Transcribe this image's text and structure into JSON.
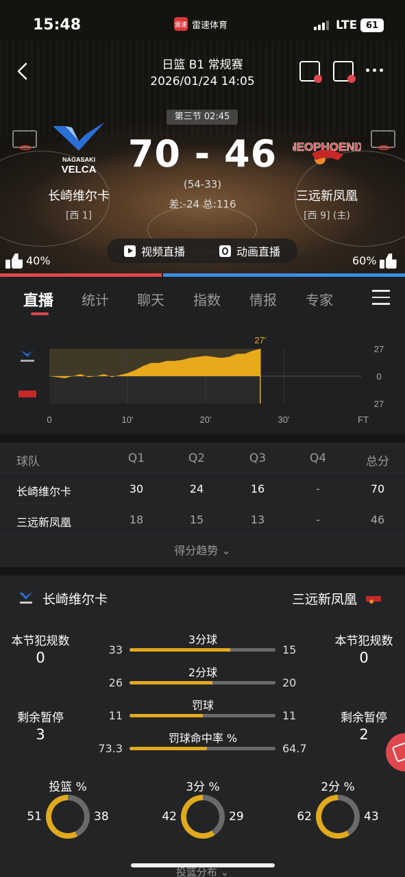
{
  "status_bar": {
    "time": "15:48",
    "app_name": "雷速体育",
    "app_logo_text": "雷速",
    "network": "LTE",
    "battery": "61"
  },
  "header": {
    "league": "日篮 B1 常规赛",
    "datetime": "2026/01/24 14:05",
    "period": "第三节 02:45"
  },
  "score": {
    "main": "70 - 46",
    "half": "(54-33)",
    "diff": "差:-24 总:116"
  },
  "home": {
    "name": "长崎维尔卡",
    "rank": "[西 1]",
    "vote": "40%",
    "logo_text": "NAGASAKI VELCA"
  },
  "away": {
    "name": "三远新凤凰",
    "rank": "[西 9] (主)",
    "vote": "60%",
    "logo_text": "NEOPHOENIX"
  },
  "live": {
    "video": "视频直播",
    "animation": "动画直播"
  },
  "tabs": [
    "直播",
    "统计",
    "聊天",
    "指数",
    "情报",
    "专家"
  ],
  "trend_chart": {
    "marker": "27'",
    "y_ticks": [
      "27",
      "0",
      "27"
    ],
    "x_ticks": [
      "0",
      "10'",
      "20'",
      "30'",
      "FT"
    ],
    "lead_series": [
      [
        0,
        0
      ],
      [
        1,
        -1
      ],
      [
        2,
        -2
      ],
      [
        3,
        0
      ],
      [
        4,
        2
      ],
      [
        5,
        -1
      ],
      [
        6,
        0
      ],
      [
        7,
        2
      ],
      [
        8,
        -1
      ],
      [
        9,
        1
      ],
      [
        10,
        3
      ],
      [
        11,
        6
      ],
      [
        12,
        10
      ],
      [
        13,
        13
      ],
      [
        14,
        13
      ],
      [
        15,
        15
      ],
      [
        16,
        15
      ],
      [
        17,
        16
      ],
      [
        18,
        18
      ],
      [
        19,
        19
      ],
      [
        20,
        20
      ],
      [
        21,
        19
      ],
      [
        22,
        18
      ],
      [
        23,
        19
      ],
      [
        24,
        22
      ],
      [
        25,
        22
      ],
      [
        26,
        25
      ],
      [
        27,
        27
      ]
    ],
    "colors": {
      "fill": "#e8a91c",
      "lead": "#e8a91c"
    }
  },
  "quarters": {
    "headers": [
      "球队",
      "Q1",
      "Q2",
      "Q3",
      "Q4",
      "总分"
    ],
    "rows": [
      [
        "长崎维尔卡",
        "30",
        "24",
        "16",
        "-",
        "70"
      ],
      [
        "三远新凤凰",
        "18",
        "15",
        "13",
        "-",
        "46"
      ]
    ],
    "trend_link": "得分趋势 ⌄"
  },
  "stats": {
    "home_name": "长崎维尔卡",
    "away_name": "三远新凤凰",
    "home_fouls_label": "本节犯规数",
    "home_fouls": "0",
    "away_fouls_label": "本节犯规数",
    "away_fouls": "0",
    "home_timeouts_label": "剩余暂停",
    "home_timeouts": "3",
    "away_timeouts_label": "剩余暂停",
    "away_timeouts": "2",
    "bars": [
      {
        "label": "3分球",
        "home": "33",
        "away": "15",
        "home_share": 0.69
      },
      {
        "label": "2分球",
        "home": "26",
        "away": "20",
        "home_share": 0.57
      },
      {
        "label": "罚球",
        "home": "11",
        "away": "11",
        "home_share": 0.5
      },
      {
        "label": "罚球命中率 %",
        "home": "73.3",
        "away": "64.7",
        "home_share": 0.53
      }
    ],
    "rings": [
      {
        "title": "投篮 %",
        "home": "51",
        "away": "38",
        "home_share": 0.573
      },
      {
        "title": "3分 %",
        "home": "42",
        "away": "29",
        "home_share": 0.592
      },
      {
        "title": "2分 %",
        "home": "62",
        "away": "43",
        "home_share": 0.59
      }
    ],
    "ring_colors": {
      "home": "#e0a91e",
      "away": "#6a6a6c"
    },
    "next_section": "投篮分布 ⌄"
  }
}
